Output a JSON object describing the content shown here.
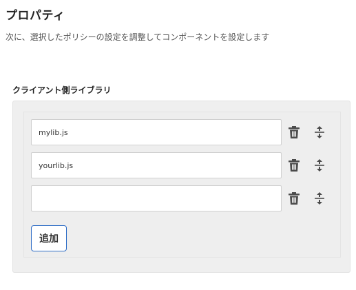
{
  "header": {
    "title": "プロパティ",
    "subtitle": "次に、選択したポリシーの設定を調整してコンポーネントを設定します"
  },
  "section": {
    "label": "クライアント側ライブラリ",
    "fields": [
      {
        "value": "mylib.js"
      },
      {
        "value": "yourlib.js"
      },
      {
        "value": ""
      }
    ],
    "add_label": "追加"
  },
  "icons": {
    "delete": "trash-icon",
    "reorder": "reorder-icon"
  }
}
